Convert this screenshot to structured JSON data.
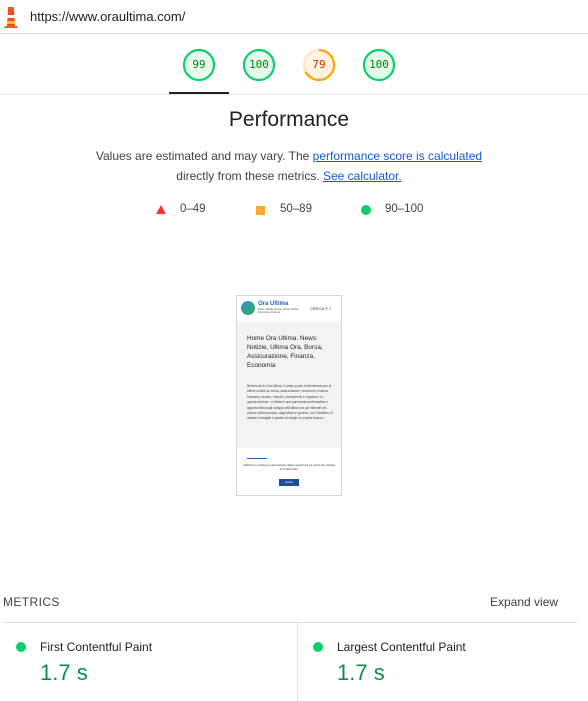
{
  "address_bar": {
    "url": "https://www.oraultima.com/"
  },
  "icons": {
    "logo": "lighthouse-icon"
  },
  "colors": {
    "pass": "#0cce6b",
    "average": "#ffa400",
    "fail": "#ff3333",
    "link": "#1558d6"
  },
  "gauges": [
    {
      "score": "99",
      "status": "pass"
    },
    {
      "score": "100",
      "status": "pass"
    },
    {
      "score": "79",
      "status": "average"
    },
    {
      "score": "100",
      "status": "pass"
    }
  ],
  "performance": {
    "title": "Performance",
    "desc_part1": "Values are estimated and may vary. The ",
    "desc_link1": "performance score is calculated",
    "desc_part2": "directly from these metrics. ",
    "desc_link2": "See calculator."
  },
  "legend": {
    "fail_range": "0–49",
    "average_range": "50–89",
    "pass_range": "90–100"
  },
  "screenshot": {
    "brand": "Ora Ultima",
    "tagline": "News, Media, Borsa, Ultime Notizie, Economia, Finanza",
    "search": "CERCA",
    "heading": "Home Ora Ultima. News: Notizie, Ultima Ora, Borsa, Assicurazione, Finanza, Economia",
    "paragraph": "Benvenuti su Ora Ultima, il vostro punto di riferimento per le ultime notizie su borsa, assicurazione, economia, finanza, business, denaro, banche, investimenti e risparmio. In questa sezione, vi offriamo una panoramica informativa e approfondita sugli sviluppi dell'ultima ora più rilevanti nel mondo dell'economia, dagli affari ai governi, con l'obiettivo di aiutare a famiglie a gestire al meglio le proprie finanze.",
    "cookie_text": "Utilizziamo i cookie per assicurarti la migliore esperienza sul nostro sito. Accetta la Cookie Policy",
    "cookie_button": "Accetto"
  },
  "metrics": {
    "label": "METRICS",
    "expand": "Expand view",
    "items": [
      {
        "name": "First Contentful Paint",
        "value": "1.7 s"
      },
      {
        "name": "Largest Contentful Paint",
        "value": "1.7 s"
      }
    ]
  }
}
